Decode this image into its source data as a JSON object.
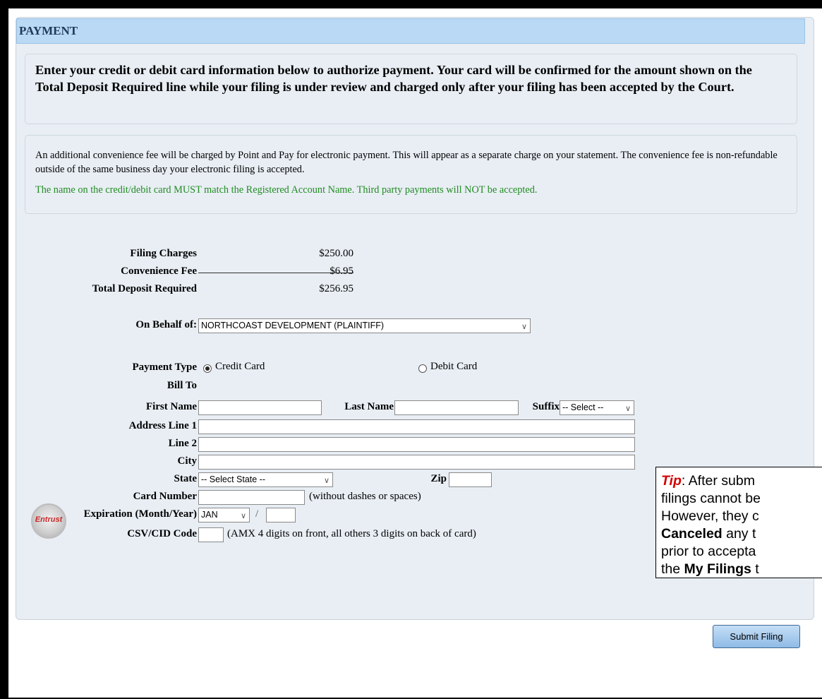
{
  "section_title": "PAYMENT",
  "intro": "Enter your credit or debit card information below to authorize payment. Your card will be confirmed for the amount shown on the Total Deposit Required line while your filing is under review and charged only after your filing has been accepted by the Court.",
  "notice": {
    "fee_text": "An additional convenience fee will be charged by Point and Pay for electronic payment. This will appear as a separate charge on your statement. The convenience fee is non-refundable outside of the same business day your electronic filing is accepted.",
    "name_warning": "The name on the credit/debit card MUST match the Registered Account Name. Third party payments will NOT be accepted.",
    "name_warning_color": "#228b22"
  },
  "charges": {
    "filing_label": "Filing Charges",
    "filing_value": "$250.00",
    "fee_label": "Convenience Fee",
    "fee_value": "$6.95",
    "total_label": "Total Deposit Required",
    "total_value": "$256.95"
  },
  "behalf": {
    "label": "On Behalf of:",
    "value": "NORTHCOAST DEVELOPMENT (PLAINTIFF)"
  },
  "payment_type": {
    "label": "Payment Type",
    "credit": "Credit Card",
    "debit": "Debit Card",
    "selected": "Credit Card"
  },
  "bill_to": {
    "label": "Bill To",
    "first_name": "First Name",
    "last_name": "Last Name",
    "suffix": "Suffix",
    "suffix_value": "-- Select --",
    "address1": "Address Line 1",
    "line2": "Line 2",
    "city": "City",
    "state": "State",
    "state_value": "-- Select State --",
    "zip": "Zip"
  },
  "card": {
    "number_label": "Card Number",
    "number_hint": "(without dashes or spaces)",
    "expiration_label": "Expiration (Month/Year)",
    "month_value": "JAN",
    "slash": "/",
    "csv_label": "CSV/CID Code",
    "csv_hint": "(AMX 4 digits on front, all others 3 digits on back of card)"
  },
  "seal": {
    "text": "Entrust"
  },
  "tip": {
    "label": "Tip",
    "line1": ": After subm",
    "line2": "filings cannot be",
    "line3": "However, they c",
    "line4_bold": "Canceled",
    "line4_rest": " any t",
    "line5": "prior to accepta",
    "line6_pre": "the ",
    "line6_bold": "My Filings",
    "line6_rest": " t"
  },
  "submit_label": "Submit Filing",
  "colors": {
    "header_bg": "#b9d9f5",
    "panel_bg": "#e8eef4",
    "tip_red": "#d50000"
  }
}
